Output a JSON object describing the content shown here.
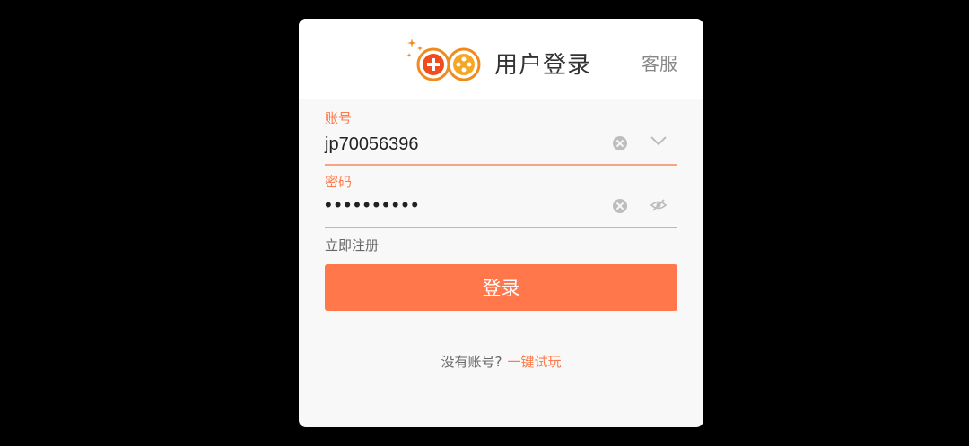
{
  "header": {
    "title": "用户登录",
    "service_label": "客服"
  },
  "account": {
    "label": "账号",
    "value": "jp70056396"
  },
  "password": {
    "label": "密码",
    "value": "••••••••••"
  },
  "register_label": "立即注册",
  "login_button_label": "登录",
  "footer": {
    "prompt": "没有账号?",
    "trial_link": "一键试玩"
  },
  "colors": {
    "accent": "#ff774a",
    "logo_orange": "#f08a1d"
  },
  "icons": [
    "gamepad-logo-icon",
    "clear-icon",
    "chevron-down-icon",
    "eye-hidden-icon"
  ]
}
